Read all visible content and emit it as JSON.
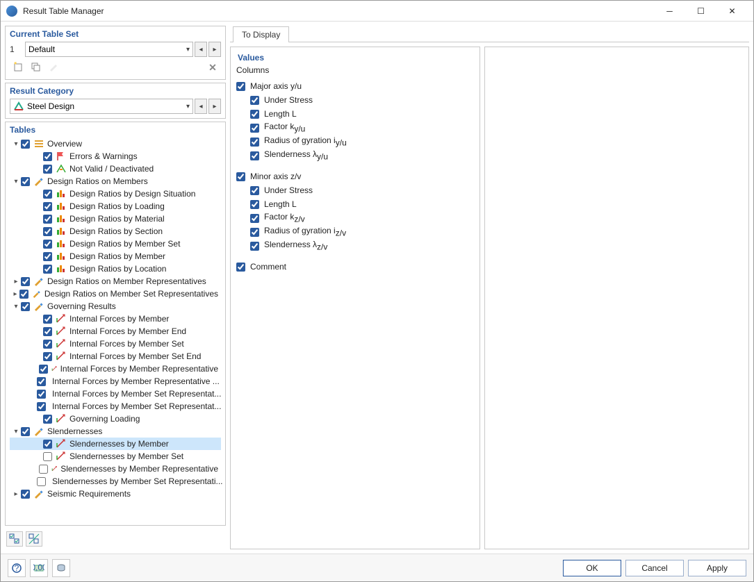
{
  "window": {
    "title": "Result Table Manager"
  },
  "current_table_set": {
    "title": "Current Table Set",
    "index": "1",
    "name": "Default"
  },
  "result_category": {
    "title": "Result Category",
    "name": "Steel Design"
  },
  "tables": {
    "title": "Tables",
    "tree": [
      {
        "label": "Overview",
        "checked": true,
        "expanded": true,
        "icon": "overview",
        "children": [
          {
            "label": "Errors & Warnings",
            "checked": true,
            "icon": "flag"
          },
          {
            "label": "Not Valid / Deactivated",
            "checked": true,
            "icon": "notvalid"
          }
        ]
      },
      {
        "label": "Design Ratios on Members",
        "checked": true,
        "expanded": true,
        "icon": "pencil",
        "children": [
          {
            "label": "Design Ratios by Design Situation",
            "checked": true,
            "icon": "ratio"
          },
          {
            "label": "Design Ratios by Loading",
            "checked": true,
            "icon": "ratio"
          },
          {
            "label": "Design Ratios by Material",
            "checked": true,
            "icon": "ratio"
          },
          {
            "label": "Design Ratios by Section",
            "checked": true,
            "icon": "ratio"
          },
          {
            "label": "Design Ratios by Member Set",
            "checked": true,
            "icon": "ratio"
          },
          {
            "label": "Design Ratios by Member",
            "checked": true,
            "icon": "ratio"
          },
          {
            "label": "Design Ratios by Location",
            "checked": true,
            "icon": "ratio"
          }
        ]
      },
      {
        "label": "Design Ratios on Member Representatives",
        "checked": true,
        "expanded": false,
        "icon": "pencil"
      },
      {
        "label": "Design Ratios on Member Set Representatives",
        "checked": true,
        "expanded": false,
        "icon": "pencil"
      },
      {
        "label": "Governing Results",
        "checked": true,
        "expanded": true,
        "icon": "pencil",
        "children": [
          {
            "label": "Internal Forces by Member",
            "checked": true,
            "icon": "force"
          },
          {
            "label": "Internal Forces by Member End",
            "checked": true,
            "icon": "force"
          },
          {
            "label": "Internal Forces by Member Set",
            "checked": true,
            "icon": "force"
          },
          {
            "label": "Internal Forces by Member Set End",
            "checked": true,
            "icon": "force"
          },
          {
            "label": "Internal Forces by Member Representative",
            "checked": true,
            "icon": "force"
          },
          {
            "label": "Internal Forces by Member Representative ...",
            "checked": true,
            "icon": "force"
          },
          {
            "label": "Internal Forces by Member Set Representat...",
            "checked": true,
            "icon": "force"
          },
          {
            "label": "Internal Forces by Member Set Representat...",
            "checked": true,
            "icon": "force"
          },
          {
            "label": "Governing Loading",
            "checked": true,
            "icon": "force"
          }
        ]
      },
      {
        "label": "Slendernesses",
        "checked": true,
        "expanded": true,
        "icon": "pencil",
        "children": [
          {
            "label": "Slendernesses by Member",
            "checked": true,
            "icon": "force",
            "selected": true
          },
          {
            "label": "Slendernesses by Member Set",
            "checked": false,
            "icon": "force"
          },
          {
            "label": "Slendernesses by Member Representative",
            "checked": false,
            "icon": "force"
          },
          {
            "label": "Slendernesses by Member Set Representati...",
            "checked": false,
            "icon": "force"
          }
        ]
      },
      {
        "label": "Seismic Requirements",
        "checked": true,
        "expanded": false,
        "icon": "pencil"
      }
    ]
  },
  "to_display": {
    "tab": "To Display",
    "values_title": "Values",
    "columns_label": "Columns",
    "groups": [
      {
        "label": "Major axis y/u",
        "checked": true,
        "items": [
          {
            "label": "Under Stress",
            "checked": true
          },
          {
            "label": "Length L",
            "checked": true
          },
          {
            "label_html": "Factor k<sub>y/u</sub>",
            "checked": true
          },
          {
            "label_html": "Radius of gyration i<sub>y/u</sub>",
            "checked": true
          },
          {
            "label_html": "Slenderness λ<sub>y/u</sub>",
            "checked": true
          }
        ]
      },
      {
        "label": "Minor axis z/v",
        "checked": true,
        "items": [
          {
            "label": "Under Stress",
            "checked": true
          },
          {
            "label": "Length L",
            "checked": true
          },
          {
            "label_html": "Factor k<sub>z/v</sub>",
            "checked": true
          },
          {
            "label_html": "Radius of gyration i<sub>z/v</sub>",
            "checked": true
          },
          {
            "label_html": "Slenderness λ<sub>z/v</sub>",
            "checked": true
          }
        ]
      }
    ],
    "comment": {
      "label": "Comment",
      "checked": true
    }
  },
  "footer": {
    "ok": "OK",
    "cancel": "Cancel",
    "apply": "Apply"
  }
}
